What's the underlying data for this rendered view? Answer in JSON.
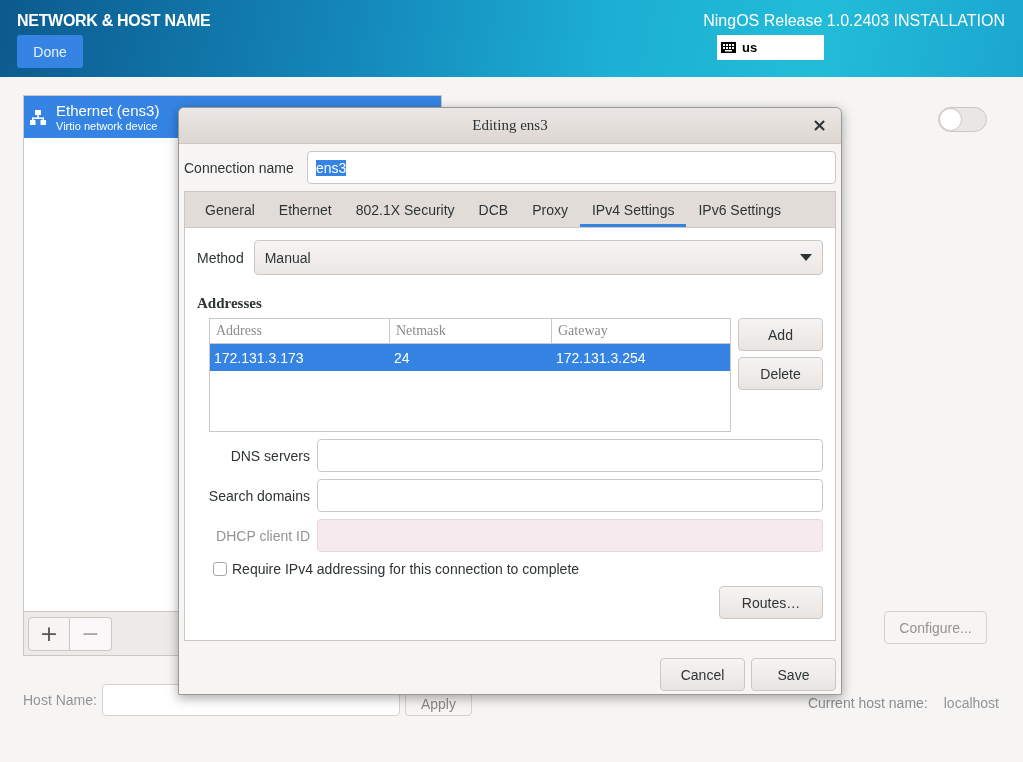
{
  "header": {
    "title": "NETWORK & HOST NAME",
    "done_button": "Done",
    "product": "NingOS Release 1.0.2403 INSTALLATION",
    "keyboard_layout": "us"
  },
  "devices": [
    {
      "name": "Ethernet (ens3)",
      "description": "Virtio network device",
      "selected": true
    }
  ],
  "device_toolbar": {
    "add": "+",
    "remove": "−",
    "remove_disabled": true
  },
  "device_switch": {
    "on": false
  },
  "configure_button": {
    "label": "Configure...",
    "disabled": true
  },
  "host_name": {
    "label": "Host Name:",
    "apply_button": "Apply",
    "current_label": "Current host name:",
    "current_value": "localhost"
  },
  "dialog": {
    "title": "Editing ens3",
    "close": "×",
    "connection_name_label": "Connection name",
    "connection_name": "ens3",
    "tabs": [
      {
        "label": "General",
        "selected": false
      },
      {
        "label": "Ethernet",
        "selected": false
      },
      {
        "label": "802.1X Security",
        "selected": false
      },
      {
        "label": "DCB",
        "selected": false
      },
      {
        "label": "Proxy",
        "selected": false
      },
      {
        "label": "IPv4 Settings",
        "selected": true
      },
      {
        "label": "IPv6 Settings",
        "selected": false
      }
    ],
    "method_label": "Method",
    "method": "Manual",
    "addresses_heading": "Addresses",
    "address_columns": [
      "Address",
      "Netmask",
      "Gateway"
    ],
    "address_rows": [
      {
        "cells": [
          "172.131.3.173",
          "24",
          "172.131.3.254"
        ],
        "selected": true
      }
    ],
    "add_button": "Add",
    "delete_button": "Delete",
    "fields": [
      {
        "label": "DNS servers",
        "disabled": false
      },
      {
        "label": "Search domains",
        "disabled": false
      },
      {
        "label": "DHCP client ID",
        "disabled": true
      }
    ],
    "require_checkbox": {
      "label": "Require IPv4 addressing for this connection to complete",
      "checked": false
    },
    "routes_button": "Routes…",
    "cancel_button": "Cancel",
    "save_button": "Save"
  }
}
